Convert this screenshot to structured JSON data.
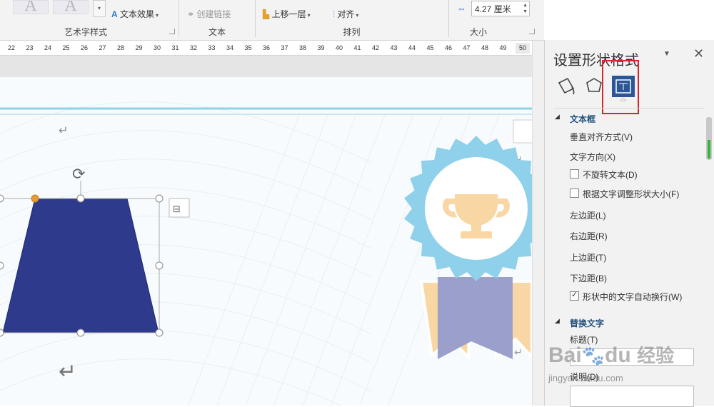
{
  "ribbon": {
    "wordart_effects_label": "文本效果",
    "create_link_label": "创建链接",
    "bring_forward_label": "上移一层",
    "align_label": "对齐",
    "size_value": "4.27 厘米",
    "groups": {
      "wordart_styles": "艺术字样式",
      "text": "文本",
      "arrange": "排列",
      "size": "大小"
    }
  },
  "ruler": {
    "ticks": [
      "22",
      "23",
      "24",
      "25",
      "26",
      "27",
      "28",
      "29",
      "30",
      "31",
      "32",
      "33",
      "34",
      "35",
      "36",
      "37",
      "38",
      "39",
      "40",
      "41",
      "42",
      "43",
      "44",
      "45",
      "46",
      "47",
      "48",
      "49"
    ],
    "end_label": "50"
  },
  "pane": {
    "title": "设置形状格式",
    "tabs": [
      "fill-line",
      "effects",
      "layout-properties"
    ],
    "textbox_section": "文本框",
    "vertical_alignment": "垂直对齐方式(V)",
    "text_direction": "文字方向(X)",
    "do_not_rotate": "不旋转文本(D)",
    "resize_shape": "根据文字调整形状大小(F)",
    "left_margin": "左边距(L)",
    "right_margin": "右边距(R)",
    "top_margin": "上边距(T)",
    "bottom_margin": "下边距(B)",
    "wrap_text": "形状中的文字自动换行(W)",
    "alt_text_section": "替换文字",
    "alt_title_label": "标题(T)",
    "alt_desc_label": "说明(D)",
    "checkbox_states": {
      "do_not_rotate": false,
      "resize_shape": false,
      "wrap_text": true
    }
  },
  "watermark": {
    "brand": "Bai",
    "brand2": "du",
    "brand_cn": "经验",
    "url": "jingyan.baidu.com"
  },
  "colors": {
    "accent_blue": "#2b5797",
    "shape_fill": "#2e3a8c",
    "highlight_red": "#d9232e",
    "badge_light_blue": "#8fd0ea",
    "trophy": "#f9d7a4",
    "ribbon_purple": "#9a9fcc"
  }
}
